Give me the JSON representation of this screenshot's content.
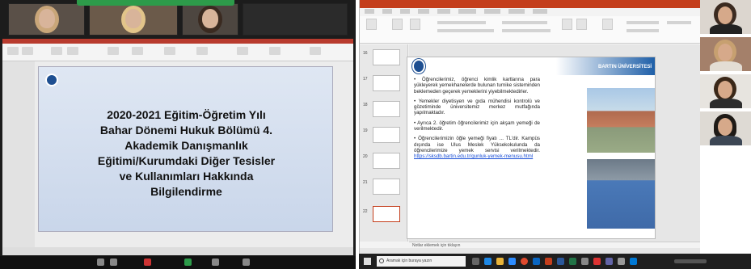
{
  "left_panel": {
    "share_banner": "",
    "inner_status": "",
    "slide_title_lines": [
      "2020-2021 Eğitim-Öğretim Yılı",
      "Bahar Dönemi Hukuk Bölümü 4.",
      "Akademik Danışmanlık",
      "Eğitimi/Kurumdaki Diğer Tesisler",
      "ve Kullanımları Hakkında",
      "Bilgilendirme"
    ]
  },
  "right_panel": {
    "university_name": "BARTIN ÜNİVERSİTESİ",
    "bullets": [
      "Öğrencilerimiz, öğrenci kimlik kartlarına para yükleyerek yemekhanelerde bulunan turnike sisteminden beklemeden geçerek yemeklerini yiyebilmektedirler.",
      "Yemekler diyetisyen ve gıda mühendisi kontrolü ve gözetiminde üniversitemiz merkez mutfağında yapılmaktadır.",
      "Ayrıca 2. öğretim öğrencilerimiz için akşam yemeği de verilmektedir.",
      "Öğrencilerimizin öğle yemeği fiyatı ... TL'dir. Kampüs dışında ise Ulus Meslek Yüksekokulunda da öğrencilerimize yemek servisi verilmektedir."
    ],
    "link": "https://sksdb.bartin.edu.tr/gunluk-yemek-menusu.html",
    "notes_placeholder": "Notlar eklemek için tıklayın",
    "slide_numbers": [
      "16",
      "17",
      "18",
      "19",
      "20",
      "21",
      "22"
    ]
  },
  "taskbar": {
    "search_placeholder": "Aramak için buraya yazın"
  },
  "colors": {
    "ppt_accent": "#c43e1c",
    "uni_blue": "#1e5fa8",
    "share_green": "#2d9b4a"
  }
}
